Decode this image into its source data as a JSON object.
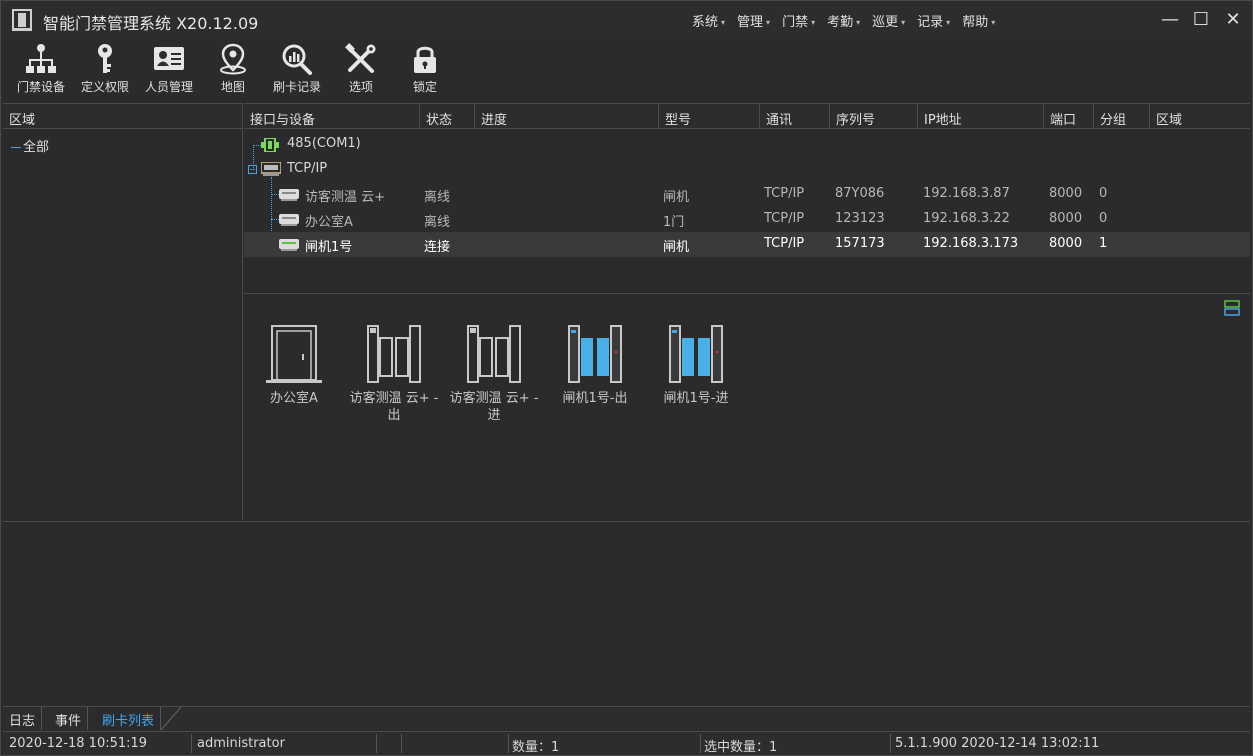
{
  "app": {
    "title": "智能门禁管理系统 X20.12.09"
  },
  "menu": [
    "系统",
    "管理",
    "门禁",
    "考勤",
    "巡更",
    "记录",
    "帮助"
  ],
  "window_controls": {
    "minimize": "—",
    "maximize": "☐",
    "close": "✕"
  },
  "toolbar": [
    {
      "label": "门禁设备",
      "icon": "network-icon"
    },
    {
      "label": "定义权限",
      "icon": "key-icon"
    },
    {
      "label": "人员管理",
      "icon": "id-card-icon"
    },
    {
      "label": "地图",
      "icon": "map-pin-icon"
    },
    {
      "label": "刷卡记录",
      "icon": "search-chart-icon"
    },
    {
      "label": "选项",
      "icon": "tools-icon"
    },
    {
      "label": "锁定",
      "icon": "lock-icon"
    }
  ],
  "left_panel": {
    "header": "区域",
    "root": "全部"
  },
  "device_table": {
    "columns": [
      "接口与设备",
      "状态",
      "进度",
      "型号",
      "通讯",
      "序列号",
      "IP地址",
      "端口",
      "分组",
      "区域"
    ],
    "interfaces": [
      {
        "name": "485(COM1)"
      },
      {
        "name": "TCP/IP"
      }
    ],
    "rows": [
      {
        "name": "访客测温 云+",
        "status": "离线",
        "progress": "",
        "model": "闸机",
        "comm": "TCP/IP",
        "serial": "87Y086",
        "ip": "192.168.3.87",
        "port": "8000",
        "group": "0",
        "area": ""
      },
      {
        "name": "办公室A",
        "status": "离线",
        "progress": "",
        "model": "1门",
        "comm": "TCP/IP",
        "serial": "123123",
        "ip": "192.168.3.22",
        "port": "8000",
        "group": "0",
        "area": ""
      },
      {
        "name": "闸机1号",
        "status": "连接",
        "progress": "",
        "model": "闸机",
        "comm": "TCP/IP",
        "serial": "157173",
        "ip": "192.168.3.173",
        "port": "8000",
        "group": "1",
        "area": ""
      }
    ]
  },
  "doors": [
    {
      "label": "办公室A",
      "type": "door"
    },
    {
      "label": "访客测温 云+ - 出",
      "type": "gate-gray"
    },
    {
      "label": "访客测温 云+ - 进",
      "type": "gate-gray"
    },
    {
      "label": "闸机1号-出",
      "type": "gate-blue"
    },
    {
      "label": "闸机1号-进",
      "type": "gate-blue"
    }
  ],
  "tabs": [
    "日志",
    "事件",
    "刷卡列表"
  ],
  "status_bar": {
    "datetime": "2020-12-18 10:51:19",
    "user": "administrator",
    "count": "数量：1",
    "selected": "选中数量：1",
    "version": "5.1.1.900  2020-12-14 13:02:11"
  },
  "colors": {
    "online": "#7cd957",
    "accent": "#3fa9f5",
    "background": "#2b2b2e"
  }
}
